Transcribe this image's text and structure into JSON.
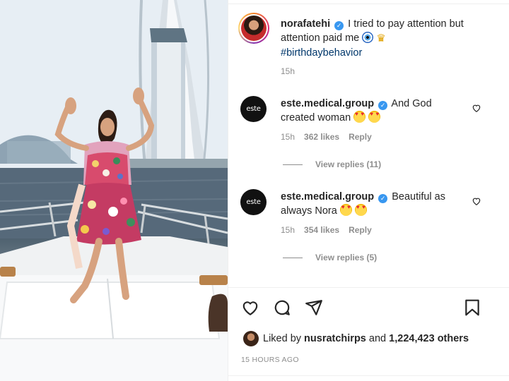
{
  "post": {
    "author": "norafatehi",
    "caption_text": "I tried to pay attention but attention paid me",
    "hashtag": "#birthdaybehavior",
    "time": "15h"
  },
  "comments": [
    {
      "author": "este.medical.group",
      "avatar_text": "este",
      "text": "And God created woman",
      "time": "15h",
      "likes": "362 likes",
      "reply_label": "Reply",
      "view_replies": "View replies (11)"
    },
    {
      "author": "este.medical.group",
      "avatar_text": "este",
      "text": "Beautiful as always Nora",
      "time": "15h",
      "likes": "354 likes",
      "reply_label": "Reply",
      "view_replies": "View replies (5)"
    }
  ],
  "likes": {
    "prefix": "Liked by",
    "user": "nusratchirps",
    "and": "and",
    "count": "1,224,423 others"
  },
  "post_age": "15 HOURS AGO",
  "icons": {
    "like": "heart-outline-icon",
    "comment": "comment-bubble-icon",
    "share": "paper-plane-icon",
    "save": "bookmark-icon",
    "verified": "verified-badge-icon"
  },
  "colors": {
    "verified": "#3897f0",
    "hashtag": "#00376b",
    "muted": "#8e8e8e",
    "text": "#262626"
  }
}
